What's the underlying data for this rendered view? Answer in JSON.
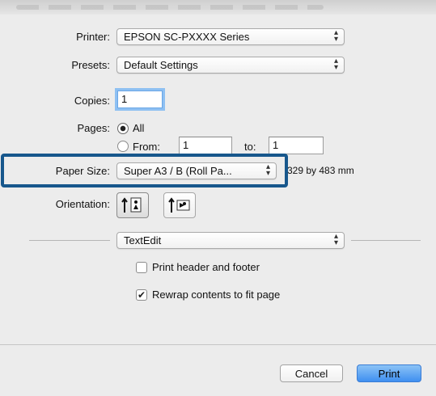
{
  "printer": {
    "label": "Printer:",
    "value": "EPSON SC-PXXXX Series"
  },
  "presets": {
    "label": "Presets:",
    "value": "Default Settings"
  },
  "copies": {
    "label": "Copies:",
    "value": "1"
  },
  "pages": {
    "label": "Pages:",
    "all_label": "All",
    "from_label": "From:",
    "from_value": "1",
    "to_label": "to:",
    "to_value": "1"
  },
  "paper_size": {
    "label": "Paper Size:",
    "value": "Super A3 / B (Roll Pa...",
    "dimensions": "329 by 483 mm"
  },
  "orientation": {
    "label": "Orientation:"
  },
  "section": {
    "value": "TextEdit"
  },
  "options": {
    "print_header_footer": {
      "label": "Print header and footer",
      "checked": false
    },
    "rewrap_contents": {
      "label": "Rewrap contents to fit page",
      "checked": true
    }
  },
  "buttons": {
    "cancel": "Cancel",
    "print": "Print"
  },
  "colors": {
    "highlight": "#17578c",
    "accent": "#3f8ff0"
  }
}
